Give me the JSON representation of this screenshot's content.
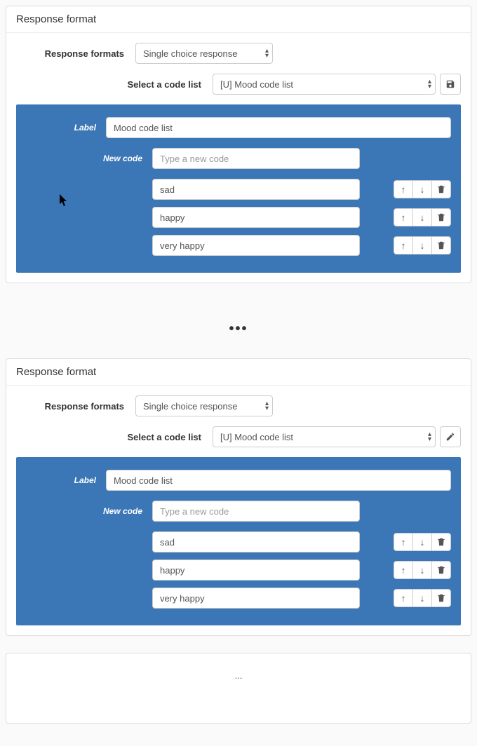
{
  "top": {
    "title": "Response format",
    "formatsLabel": "Response formats",
    "formatOption": "Single choice response",
    "codeListLabel": "Select a code list",
    "codeListOption": "[U] Mood code list",
    "labelLabel": "Label",
    "labelValue": "Mood code list",
    "newCodeLabel": "New code",
    "newCodePlaceholder": "Type a new code",
    "codes": [
      "sad",
      "happy",
      "very happy"
    ]
  },
  "bottom": {
    "title": "Response format",
    "formatsLabel": "Response formats",
    "formatOption": "Single choice response",
    "codeListLabel": "Select a code list",
    "codeListOption": "[U] Mood code list",
    "labelLabel": "Label",
    "labelValue": "Mood code list",
    "newCodeLabel": "New code",
    "newCodePlaceholder": "Type a new code",
    "codes": [
      "sad",
      "happy",
      "very happy"
    ]
  },
  "separators": {
    "dots": "•••",
    "small": "..."
  }
}
